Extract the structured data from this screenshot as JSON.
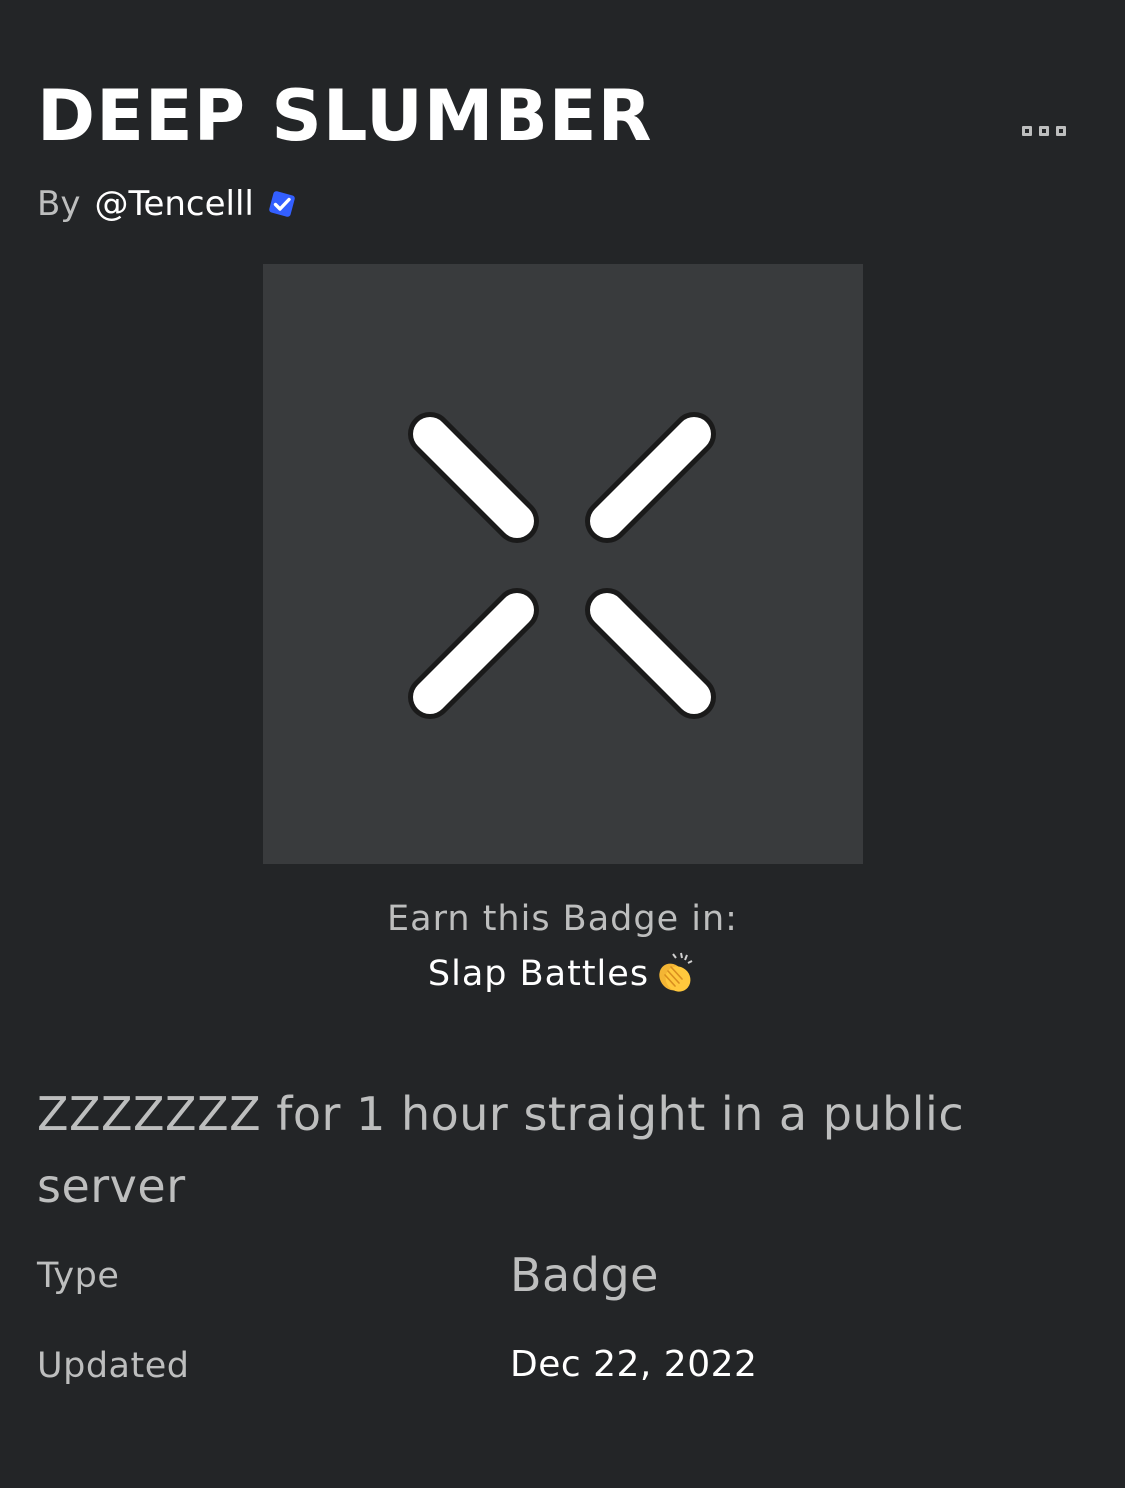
{
  "badge": {
    "title": "DEEP SLUMBER",
    "by_label": "By",
    "creator": "@Tencelll",
    "creator_verified": true,
    "image_icon": "sleeping-eyes-icon",
    "image_background": "#393b3d"
  },
  "earn": {
    "label": "Earn this Badge in:",
    "game_name": "Slap Battles",
    "game_icon": "clapping-hands-icon"
  },
  "description": "ZZZZZZZ for 1 hour straight in a public server",
  "details": {
    "type_label": "Type",
    "type_value": "Badge",
    "updated_label": "Updated",
    "updated_value": "Dec 22, 2022"
  },
  "menu": {
    "icon": "more-options-icon"
  },
  "colors": {
    "background": "#232527",
    "verified": "#335fff",
    "secondary_text": "#bdbebe"
  }
}
